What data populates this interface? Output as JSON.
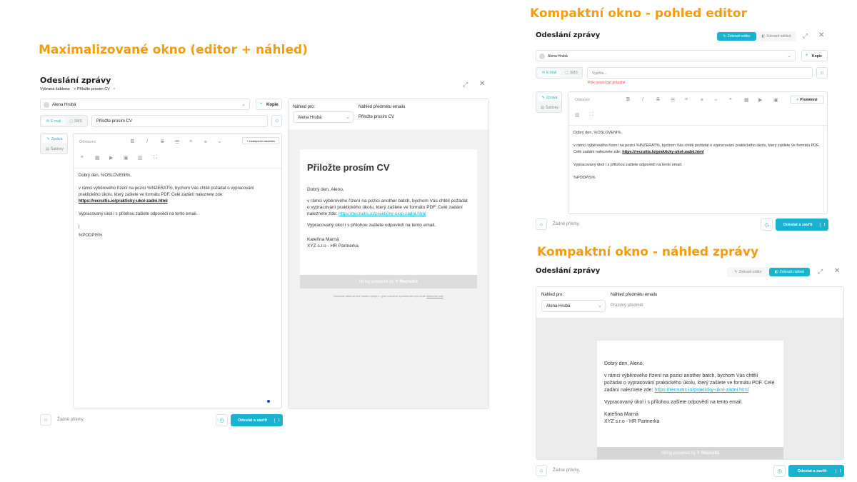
{
  "captions": {
    "maximized": "Maximalizované okno (editor + náhled)",
    "compact_editor": "Kompaktní okno - pohled editor",
    "compact_preview": "Kompaktní okno - náhled zprávy"
  },
  "colors": {
    "caption": "#f39c12",
    "accent": "#19b3cf",
    "error": "#e74c3c"
  },
  "dialog_title": "Odeslání zprávy",
  "template": {
    "label": "Vybraná šablona:",
    "value": "Přiložte prosím CV"
  },
  "recipient": "Alena Hrubá",
  "copy_button": "Kopie",
  "channels": {
    "email": "E-mail",
    "sms": "SMS"
  },
  "subject": {
    "value": "Přiložte prosím CV",
    "placeholder": "Vyplňte...",
    "error": "Pole nesmí být prázdné"
  },
  "editor_tabs": {
    "message": "Zpráva",
    "templates": "Šablony"
  },
  "toolbar": {
    "paragraph": "Odstavec",
    "variables": "Proměnné",
    "variables_small": "+ emailpanel.variables"
  },
  "message": {
    "greeting": "Dobrý den, %OSLOVENI%,",
    "line1": "v rámci výběrového řízení na pozici %INZERAT%, bychom Vás chtěli požádat o vypracování praktického úkolu, který zašlete ve formátu PDF. Celé zadání naleznete zde:",
    "link": "https://recruitis.io/prakticky-ukol-zadni.html",
    "line2": "Vypracovaný úkol i s přílohou zašlete odpovědí na tento email.",
    "signature": "%PODPIS%"
  },
  "preview": {
    "for_label": "Náhled pro:",
    "subject_label": "Náhled předmětu emailu",
    "subject_value": "Přiložte prosím CV",
    "subject_empty": "Prázdný předmět",
    "heading": "Přiložte prosím CV",
    "greeting": "Dobrý den, Aleno,",
    "line1": "v rámci výběrového řízení na pozici another batch, bychom Vás chtěli požádat o vypracování praktického úkolu, který zašlete ve formátu PDF. Celé zadání naleznete zde:",
    "link": "https://recruitis.io/prakticky-ukol-zadni.html",
    "line2": "Vypracovaný úkol i s přílohou zašlete odpovědí na tento email.",
    "sig_name": "Kateřina Marná",
    "sig_company": "XYZ s.r.o - HR Partnerka",
    "powered": "Hiring powered by",
    "brand": "Recruitis",
    "footer_note": "Možnost odebrat své osobní údaje z výše uvedené společnosti sprovede",
    "footer_link": "kliknutím zde"
  },
  "attachments": "Žádné přílohy.",
  "send_button": "Odeslat a zavřít",
  "view_buttons": {
    "editor": "Zobrazit editor",
    "preview": "Zobrazit náhled"
  }
}
